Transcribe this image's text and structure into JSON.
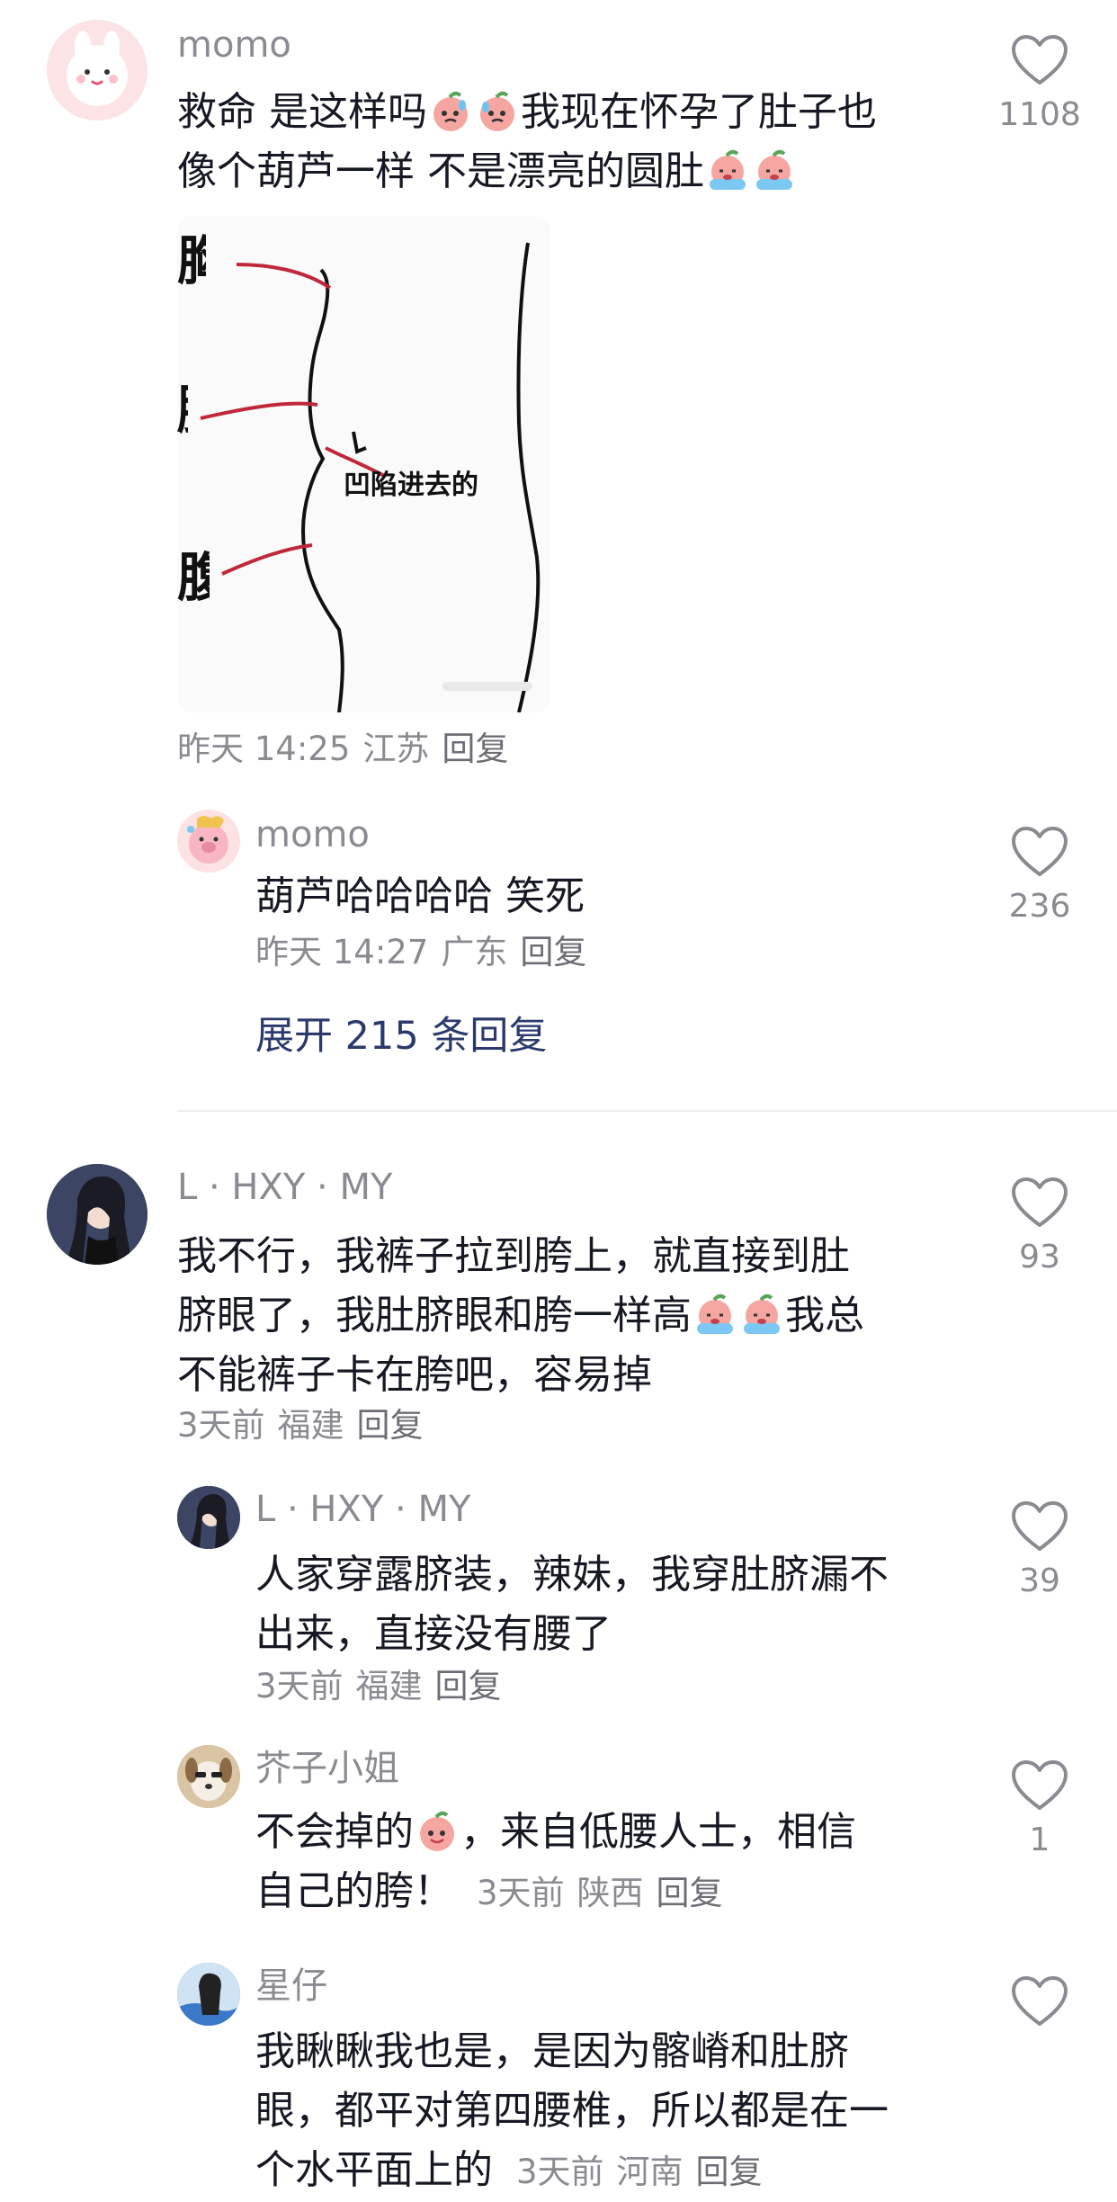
{
  "comments": [
    {
      "author": "momo",
      "text_line1_a": "救命 是这样吗",
      "text_line1_b": "我现在怀孕了肚子也",
      "text_line2": "像个葫芦一样 不是漂亮的圆肚",
      "image_labels": {
        "chest": "胸",
        "waist": "腰",
        "belly": "腹",
        "annotation": "凹陷进去的"
      },
      "time": "昨天 14:25",
      "location": "江苏",
      "reply_label": "回复",
      "likes": "1108"
    },
    {
      "author": "momo",
      "text": "葫芦哈哈哈哈 笑死",
      "time": "昨天 14:27",
      "location": "广东",
      "reply_label": "回复",
      "likes": "236"
    },
    {
      "expand_label": "展开 215 条回复"
    },
    {
      "author": "L · HXY · MY",
      "text_line1": "我不行，我裤子拉到胯上，就直接到肚",
      "text_line2_a": "脐眼了，我肚脐眼和胯一样高",
      "text_line2_b": "我总",
      "text_line3": "不能裤子卡在胯吧，容易掉",
      "time": "3天前",
      "location": "福建",
      "reply_label": "回复",
      "likes": "93"
    },
    {
      "author": "L · HXY · MY",
      "text_line1": "人家穿露脐装，辣妹，我穿肚脐漏不",
      "text_line2": "出来，直接没有腰了",
      "time": "3天前",
      "location": "福建",
      "reply_label": "回复",
      "likes": "39"
    },
    {
      "author": "芥子小姐",
      "text_line1_a": "不会掉的",
      "text_line1_b": "，来自低腰人士，相信",
      "text_line2": "自己的胯！",
      "time": "3天前",
      "location": "陕西",
      "reply_label": "回复",
      "likes": "1"
    },
    {
      "author": "星仔",
      "text_line1": "我瞅瞅我也是，是因为髂嵴和肚脐",
      "text_line2": "眼，都平对第四腰椎，所以都是在一",
      "text_line3": "个水平面上的",
      "time": "3天前",
      "location": "河南",
      "reply_label": "回复"
    }
  ],
  "icons": {
    "like": "heart-outline-icon",
    "emoji_sweat": "peach-sweat-emoji",
    "emoji_cry": "peach-crying-emoji",
    "emoji_peach": "peach-emoji"
  },
  "colors": {
    "text": "#161823",
    "secondary": "#8a8b91",
    "expand_link": "#2b3a6b",
    "annotation_red": "#c0283a"
  }
}
